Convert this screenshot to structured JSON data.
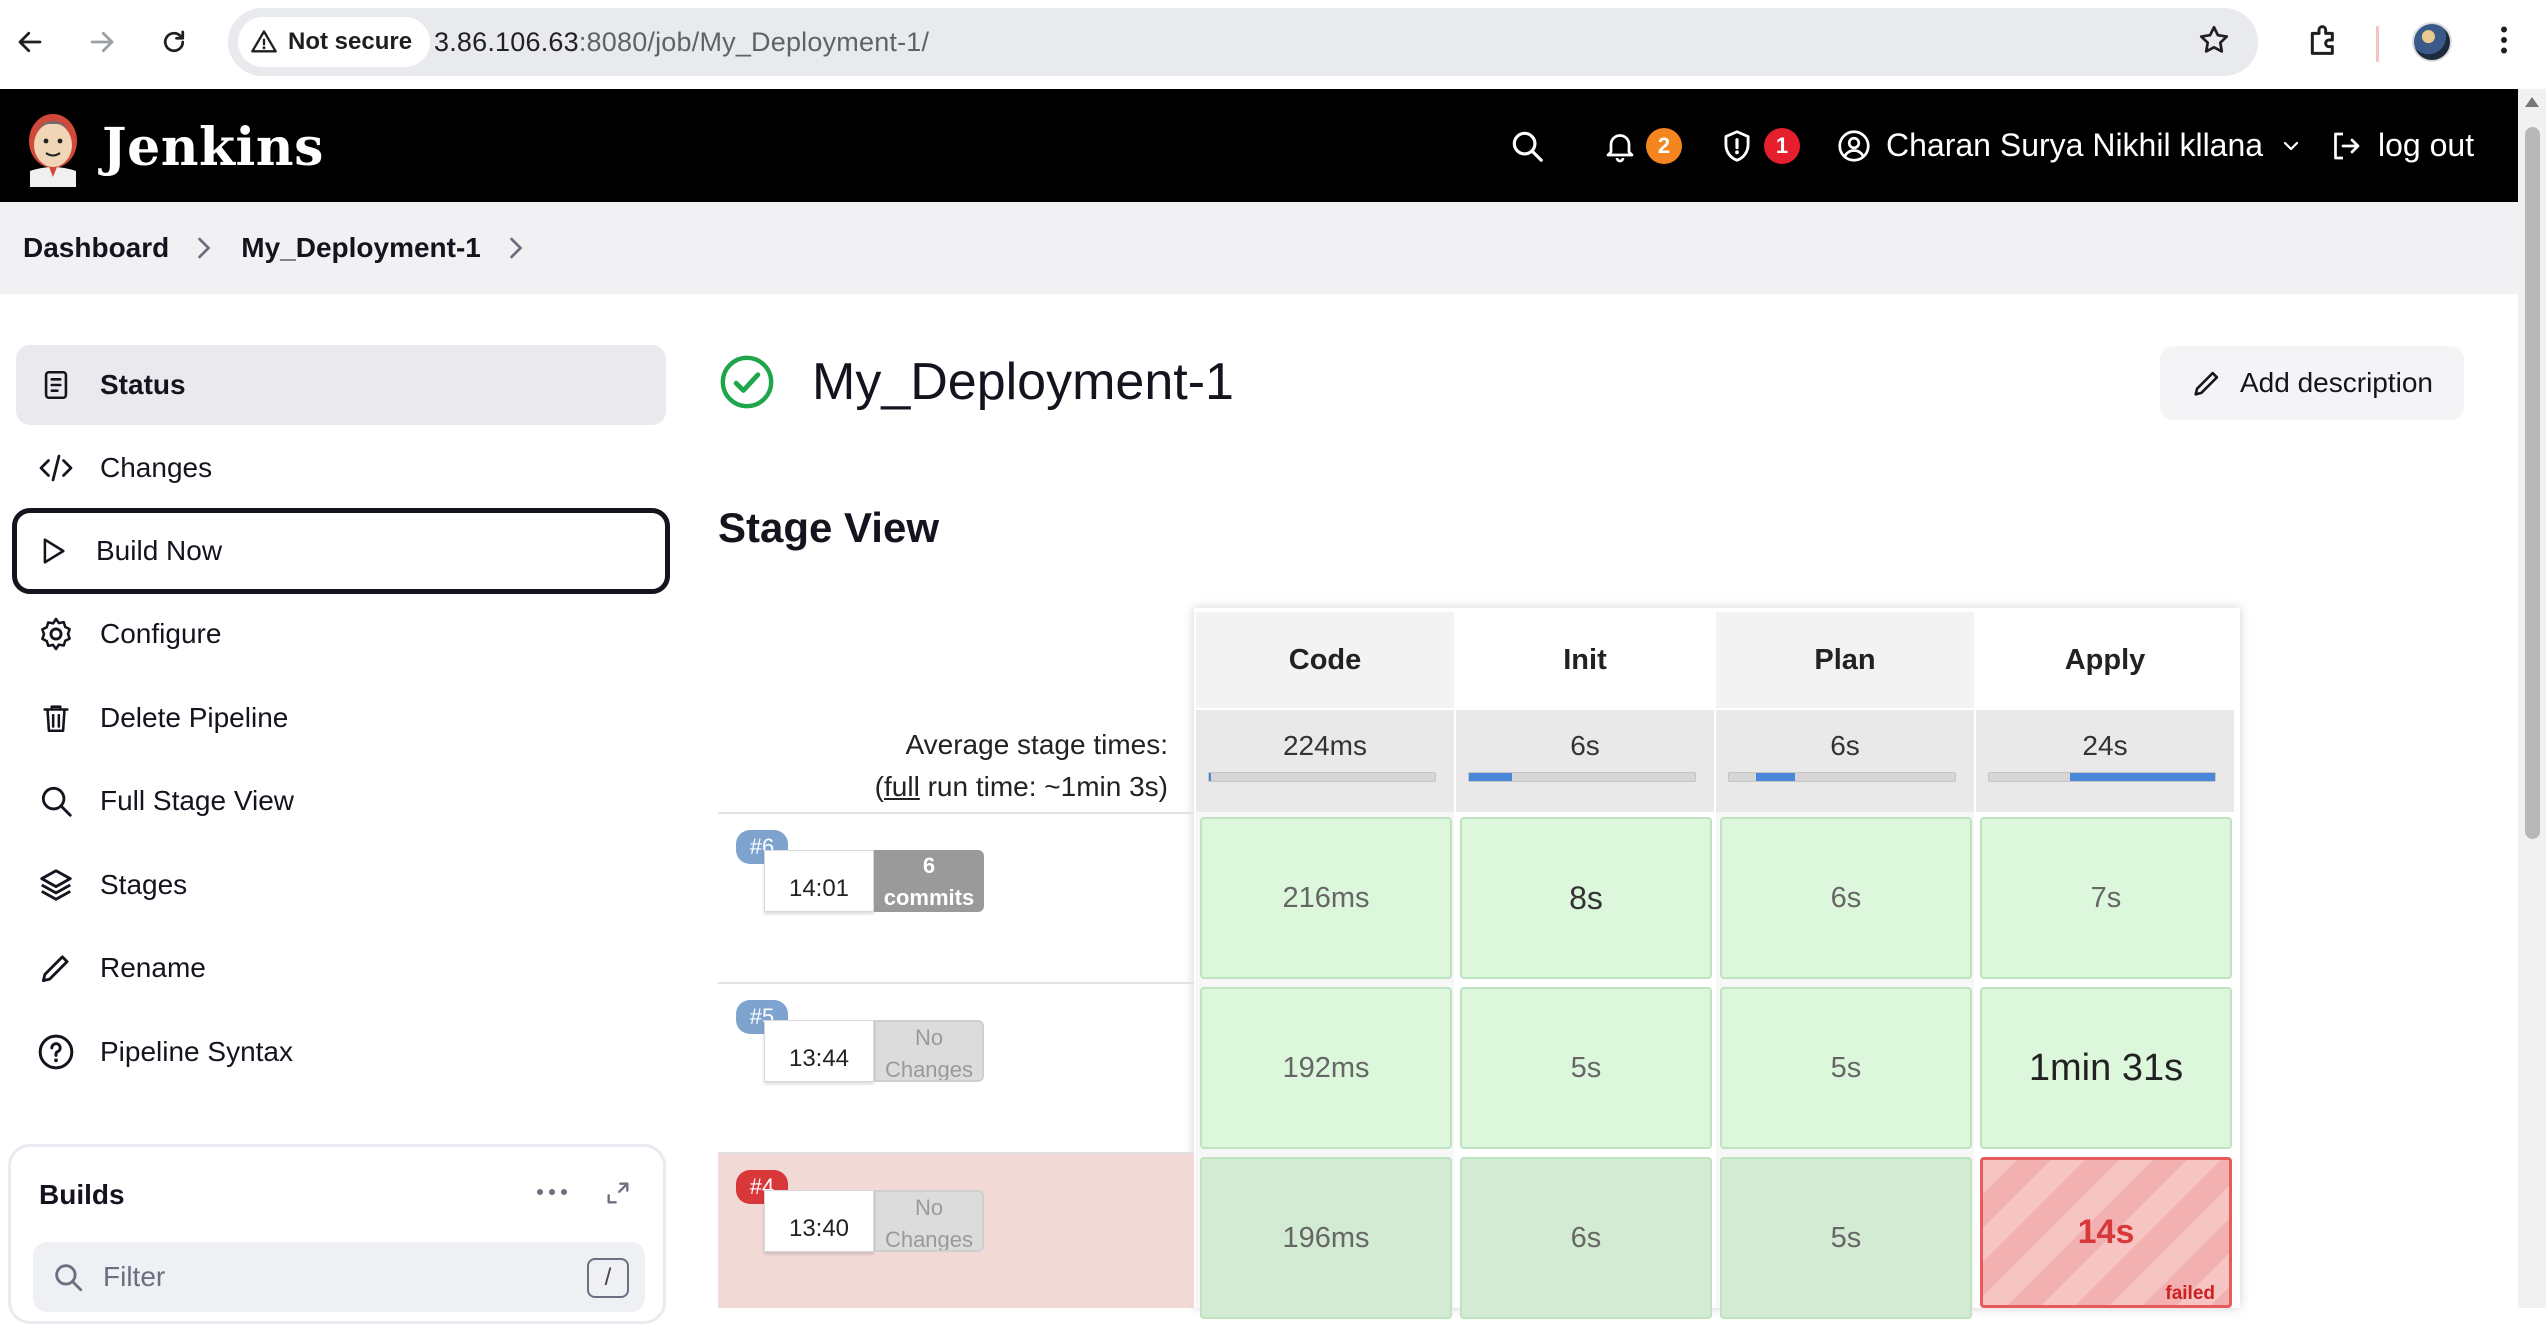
{
  "browser": {
    "security_label": "Not secure",
    "url_host": "3.86.106.63",
    "url_rest": ":8080/job/My_Deployment-1/"
  },
  "header": {
    "brand": "Jenkins",
    "notifications_count": "2",
    "security_count": "1",
    "user_name": "Charan Surya Nikhil kllana",
    "logout_label": "log out",
    "colors": {
      "notify_badge": "#f5861f",
      "security_badge": "#e5202c"
    }
  },
  "breadcrumb": {
    "items": [
      "Dashboard",
      "My_Deployment-1"
    ]
  },
  "sidebar": {
    "items": [
      {
        "label": "Status",
        "icon": "document-icon"
      },
      {
        "label": "Changes",
        "icon": "code-icon"
      },
      {
        "label": "Build Now",
        "icon": "play-icon"
      },
      {
        "label": "Configure",
        "icon": "gear-icon"
      },
      {
        "label": "Delete Pipeline",
        "icon": "trash-icon"
      },
      {
        "label": "Full Stage View",
        "icon": "search-icon"
      },
      {
        "label": "Stages",
        "icon": "layers-icon"
      },
      {
        "label": "Rename",
        "icon": "pencil-icon"
      },
      {
        "label": "Pipeline Syntax",
        "icon": "help-icon"
      }
    ],
    "builds": {
      "title": "Builds",
      "filter_placeholder": "Filter",
      "shortcut_key": "/"
    }
  },
  "main": {
    "title": "My_Deployment-1",
    "add_description_label": "Add description",
    "stage_view_title": "Stage View"
  },
  "stage_view": {
    "stages": [
      "Code",
      "Init",
      "Plan",
      "Apply"
    ],
    "average_label": "Average stage times:",
    "full_run_prefix": "(",
    "full_run_link": "full",
    "full_run_suffix": " run time: ~1min 3s)",
    "average_times": [
      "224ms",
      "6s",
      "6s",
      "24s"
    ],
    "average_bar_fractions": [
      0.01,
      0.19,
      0.17,
      0.64
    ],
    "runs": [
      {
        "build": "#6",
        "time": "14:01",
        "changes_line1": "6",
        "changes_line2": "commits",
        "changes_type": "commits",
        "status": "success",
        "durations": [
          "216ms",
          "8s",
          "6s",
          "7s"
        ]
      },
      {
        "build": "#5",
        "time": "13:44",
        "changes_line1": "No",
        "changes_line2": "Changes",
        "changes_type": "none",
        "status": "success",
        "durations": [
          "192ms",
          "5s",
          "5s",
          "1min 31s"
        ]
      },
      {
        "build": "#4",
        "time": "13:40",
        "changes_line1": "No",
        "changes_line2": "Changes",
        "changes_type": "none",
        "status": "failed",
        "durations": [
          "196ms",
          "6s",
          "5s",
          "14s"
        ],
        "failed_label": "failed"
      }
    ],
    "colors": {
      "success_cell": "#dcf7dc",
      "failed_cell": "#f7c4c4",
      "failed_row": "#f1d9d5",
      "build_badge_success": "#7fa3cf",
      "build_badge_failed": "#d9383a",
      "average_bar_fill": "#4a86d9"
    }
  }
}
